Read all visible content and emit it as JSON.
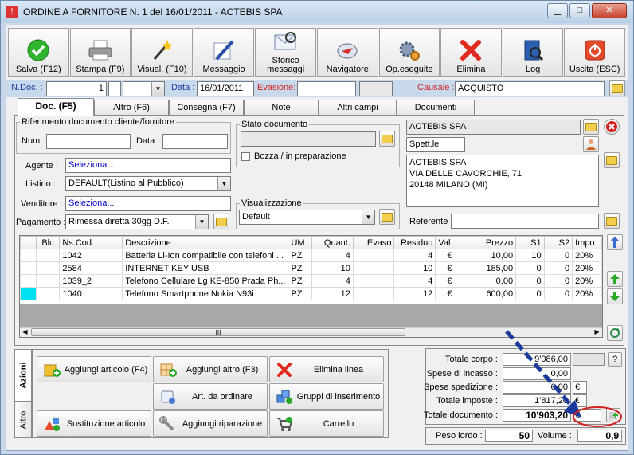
{
  "window": {
    "title": "ORDINE A FORNITORE N. 1  del 16/01/2011 - ACTEBIS SPA",
    "min": "▁",
    "max": "□",
    "close": "✕"
  },
  "toolbar": [
    {
      "label": "Salva (F12)",
      "icon": "check-icon"
    },
    {
      "label": "Stampa (F9)",
      "icon": "printer-icon"
    },
    {
      "label": "Visual. (F10)",
      "icon": "magic-wand-icon"
    },
    {
      "label": "Messaggio",
      "icon": "pen-icon"
    },
    {
      "label": "Storico messaggi",
      "icon": "envelope-icon"
    },
    {
      "label": "Navigatore",
      "icon": "compass-icon"
    },
    {
      "label": "Op.eseguite",
      "icon": "gears-icon"
    },
    {
      "label": "Elimina",
      "icon": "x-icon"
    },
    {
      "label": "Log",
      "icon": "book-icon"
    },
    {
      "label": "Uscita (ESC)",
      "icon": "power-icon"
    }
  ],
  "header": {
    "ndoc_label": "N.Doc. :",
    "ndoc_value": "1",
    "data_label": "Data :",
    "data_value": "16/01/2011",
    "evasione_label": "Evasione:",
    "causale_label": "Causale :",
    "causale_value": "ACQUISTO"
  },
  "tabs": [
    "Doc. (F5)",
    "Altro (F6)",
    "Consegna (F7)",
    "Note",
    "Altri campi",
    "Documenti"
  ],
  "rif": {
    "title": "Riferimento documento cliente/fornitore",
    "num_label": "Num.:",
    "data_label": "Data :"
  },
  "stato": {
    "title": "Stato documento",
    "bozza_label": "Bozza / in preparazione"
  },
  "form": {
    "agente_label": "Agente :",
    "agente_value": "Seleziona...",
    "listino_label": "Listino :",
    "listino_value": "DEFAULT(Listino al Pubblico)",
    "venditore_label": "Venditore :",
    "venditore_value": "Seleziona...",
    "pagamento_label": "Pagamento :",
    "pagamento_value": "Rimessa diretta 30gg D.F."
  },
  "visualizzazione": {
    "title": "Visualizzazione",
    "value": "Default"
  },
  "supplier": {
    "name": "ACTEBIS SPA",
    "salutation": "Spett.le",
    "address": [
      "ACTEBIS SPA",
      "VIA DELLE CAVORCHIE, 71",
      "20148 MILANO (MI)"
    ],
    "referente_label": "Referente"
  },
  "grid": {
    "headers": [
      "Blc",
      "Ns.Cod.",
      "Descrizione",
      "UM",
      "Quant.",
      "Evaso",
      "Residuo",
      "Val",
      "Prezzo",
      "S1",
      "S2",
      "Impo"
    ],
    "rows": [
      [
        "",
        "1042",
        "Batteria Li-Ion compatibile con telefoni ...",
        "PZ",
        "4",
        "",
        "4",
        "€",
        "10,00",
        "10",
        "0",
        "20%"
      ],
      [
        "",
        "2584",
        "INTERNET KEY USB",
        "PZ",
        "10",
        "",
        "10",
        "€",
        "185,00",
        "0",
        "0",
        "20%"
      ],
      [
        "",
        "1039_2",
        "Telefono Cellulare Lg KE-850 Prada Ph...",
        "PZ",
        "4",
        "",
        "4",
        "€",
        "0,00",
        "0",
        "0",
        "20%"
      ],
      [
        "",
        "1040",
        "Telefono Smartphone Nokia N93i",
        "PZ",
        "12",
        "",
        "12",
        "€",
        "600,00",
        "0",
        "0",
        "20%"
      ]
    ],
    "scroll_grip": "III"
  },
  "actions": {
    "vtabs": [
      "Azioni",
      "Altro"
    ],
    "buttons": [
      "Aggiungi articolo (F4)",
      "Aggiungi altro (F3)",
      "Elimina linea",
      "Art. da ordinare",
      "Gruppi di inserimento",
      "Sostituzione articolo",
      "Aggiungi riparazione",
      "Carrello"
    ]
  },
  "totals": {
    "corpo_label": "Totale corpo :",
    "corpo_value": "9'086,00",
    "incasso_label": "Spese di incasso :",
    "incasso_value": "0,00",
    "spedizione_label": "Spese spedizione :",
    "spedizione_value": "0,00",
    "imposte_label": "Totale imposte :",
    "imposte_value": "1'817,20",
    "documento_label": "Totale documento :",
    "documento_value": "10'903,20",
    "currency": "€",
    "help": "?",
    "peso_label": "Peso lordo :",
    "peso_value": "50",
    "volume_label": "Volume :",
    "volume_value": "0,9"
  },
  "colors": {
    "accent": "#1a3a9c",
    "highlight": "#d32020",
    "selected_cell": "#00e0f0"
  }
}
